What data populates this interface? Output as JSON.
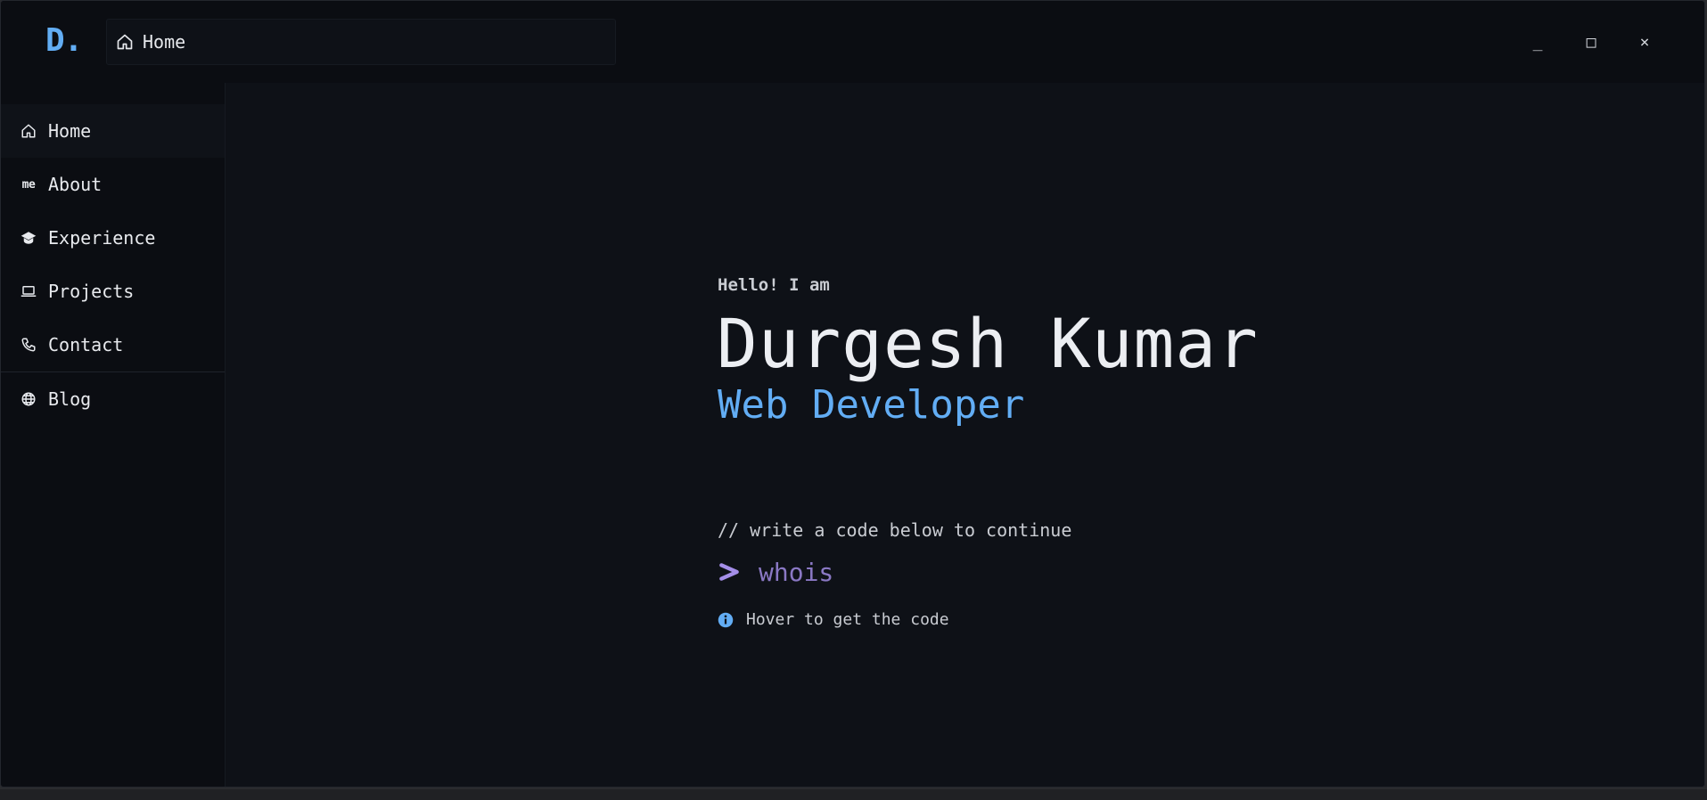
{
  "app": {
    "logo": "D.",
    "tab_label": "Home"
  },
  "window_controls": {
    "minimize": "_",
    "maximize": "□",
    "close": "×"
  },
  "sidebar": {
    "items": [
      {
        "label": "Home",
        "icon": "home-icon",
        "active": true
      },
      {
        "label": "About",
        "icon": "me-icon",
        "icon_text": "me"
      },
      {
        "label": "Experience",
        "icon": "graduation-cap-icon"
      },
      {
        "label": "Projects",
        "icon": "laptop-icon"
      },
      {
        "label": "Contact",
        "icon": "phone-icon"
      },
      {
        "label": "Blog",
        "icon": "globe-icon"
      }
    ]
  },
  "hero": {
    "greeting": "Hello! I am",
    "name": "Durgesh Kumar",
    "role": "Web Developer",
    "code_hint": "// write a code below to continue",
    "command_value": "whois",
    "info_text": "Hover to get the code"
  },
  "colors": {
    "accent": "#62adf4",
    "command": "#8a78c4",
    "prompt": "#a48ee8",
    "background": "#0e1117",
    "sidebar_bg": "#0b0d12"
  }
}
